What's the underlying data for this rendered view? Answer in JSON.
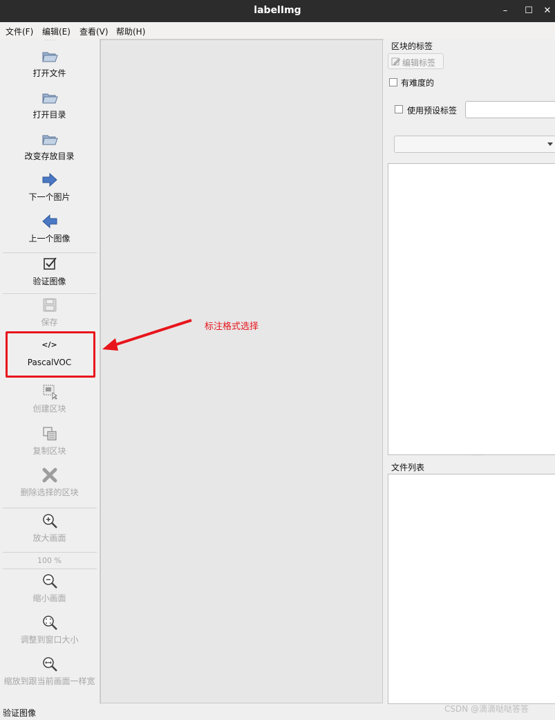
{
  "window": {
    "title": "labelImg",
    "minimize": "–",
    "maximize": "☐",
    "close": "✕"
  },
  "menu": [
    "文件(F)",
    "编辑(E)",
    "查看(V)",
    "帮助(H)"
  ],
  "toolbar": [
    {
      "label": "打开文件",
      "icon": "folder-open-icon",
      "enabled": true
    },
    {
      "label": "打开目录",
      "icon": "folder-open-icon",
      "enabled": true
    },
    {
      "label": "改变存放目录",
      "icon": "folder-open-icon",
      "enabled": true
    },
    {
      "label": "下一个图片",
      "icon": "arrow-right-icon",
      "enabled": true
    },
    {
      "label": "上一个图像",
      "icon": "arrow-left-icon",
      "enabled": true
    },
    {
      "label": "验证图像",
      "icon": "checkbox-icon",
      "enabled": true
    },
    {
      "label": "保存",
      "icon": "save-icon",
      "enabled": false
    },
    {
      "label": "PascalVOC",
      "icon": "code-format-icon",
      "glyph": "</>",
      "enabled": true
    },
    {
      "label": "创建区块",
      "icon": "create-box-icon",
      "enabled": false
    },
    {
      "label": "复制区块",
      "icon": "copy-box-icon",
      "enabled": false
    },
    {
      "label": "删除选择的区块",
      "icon": "delete-x-icon",
      "enabled": false
    },
    {
      "label": "放大画面",
      "icon": "zoom-in-icon",
      "enabled": false
    },
    {
      "label": "缩小画面",
      "icon": "zoom-out-icon",
      "enabled": false
    },
    {
      "label": "调整到窗口大小",
      "icon": "fit-window-icon",
      "enabled": false
    },
    {
      "label": "缩放到跟当前画面一样宽",
      "icon": "fit-width-icon",
      "enabled": false
    }
  ],
  "zoom": "100 %",
  "label_panel": {
    "title": "区块的标签",
    "edit_label": "编辑标签",
    "difficult": "有难度的",
    "use_default": "使用预设标签",
    "default_value": "",
    "combo_value": ""
  },
  "file_panel": {
    "title": "文件列表"
  },
  "annotation": "标注格式选择",
  "status": "验证图像",
  "watermark": "CSDN @滴滴哒哒答答",
  "colors": {
    "annotation": "#e8141b",
    "icon_blue": "#4a78c4",
    "disabled": "#a6a6a6"
  }
}
